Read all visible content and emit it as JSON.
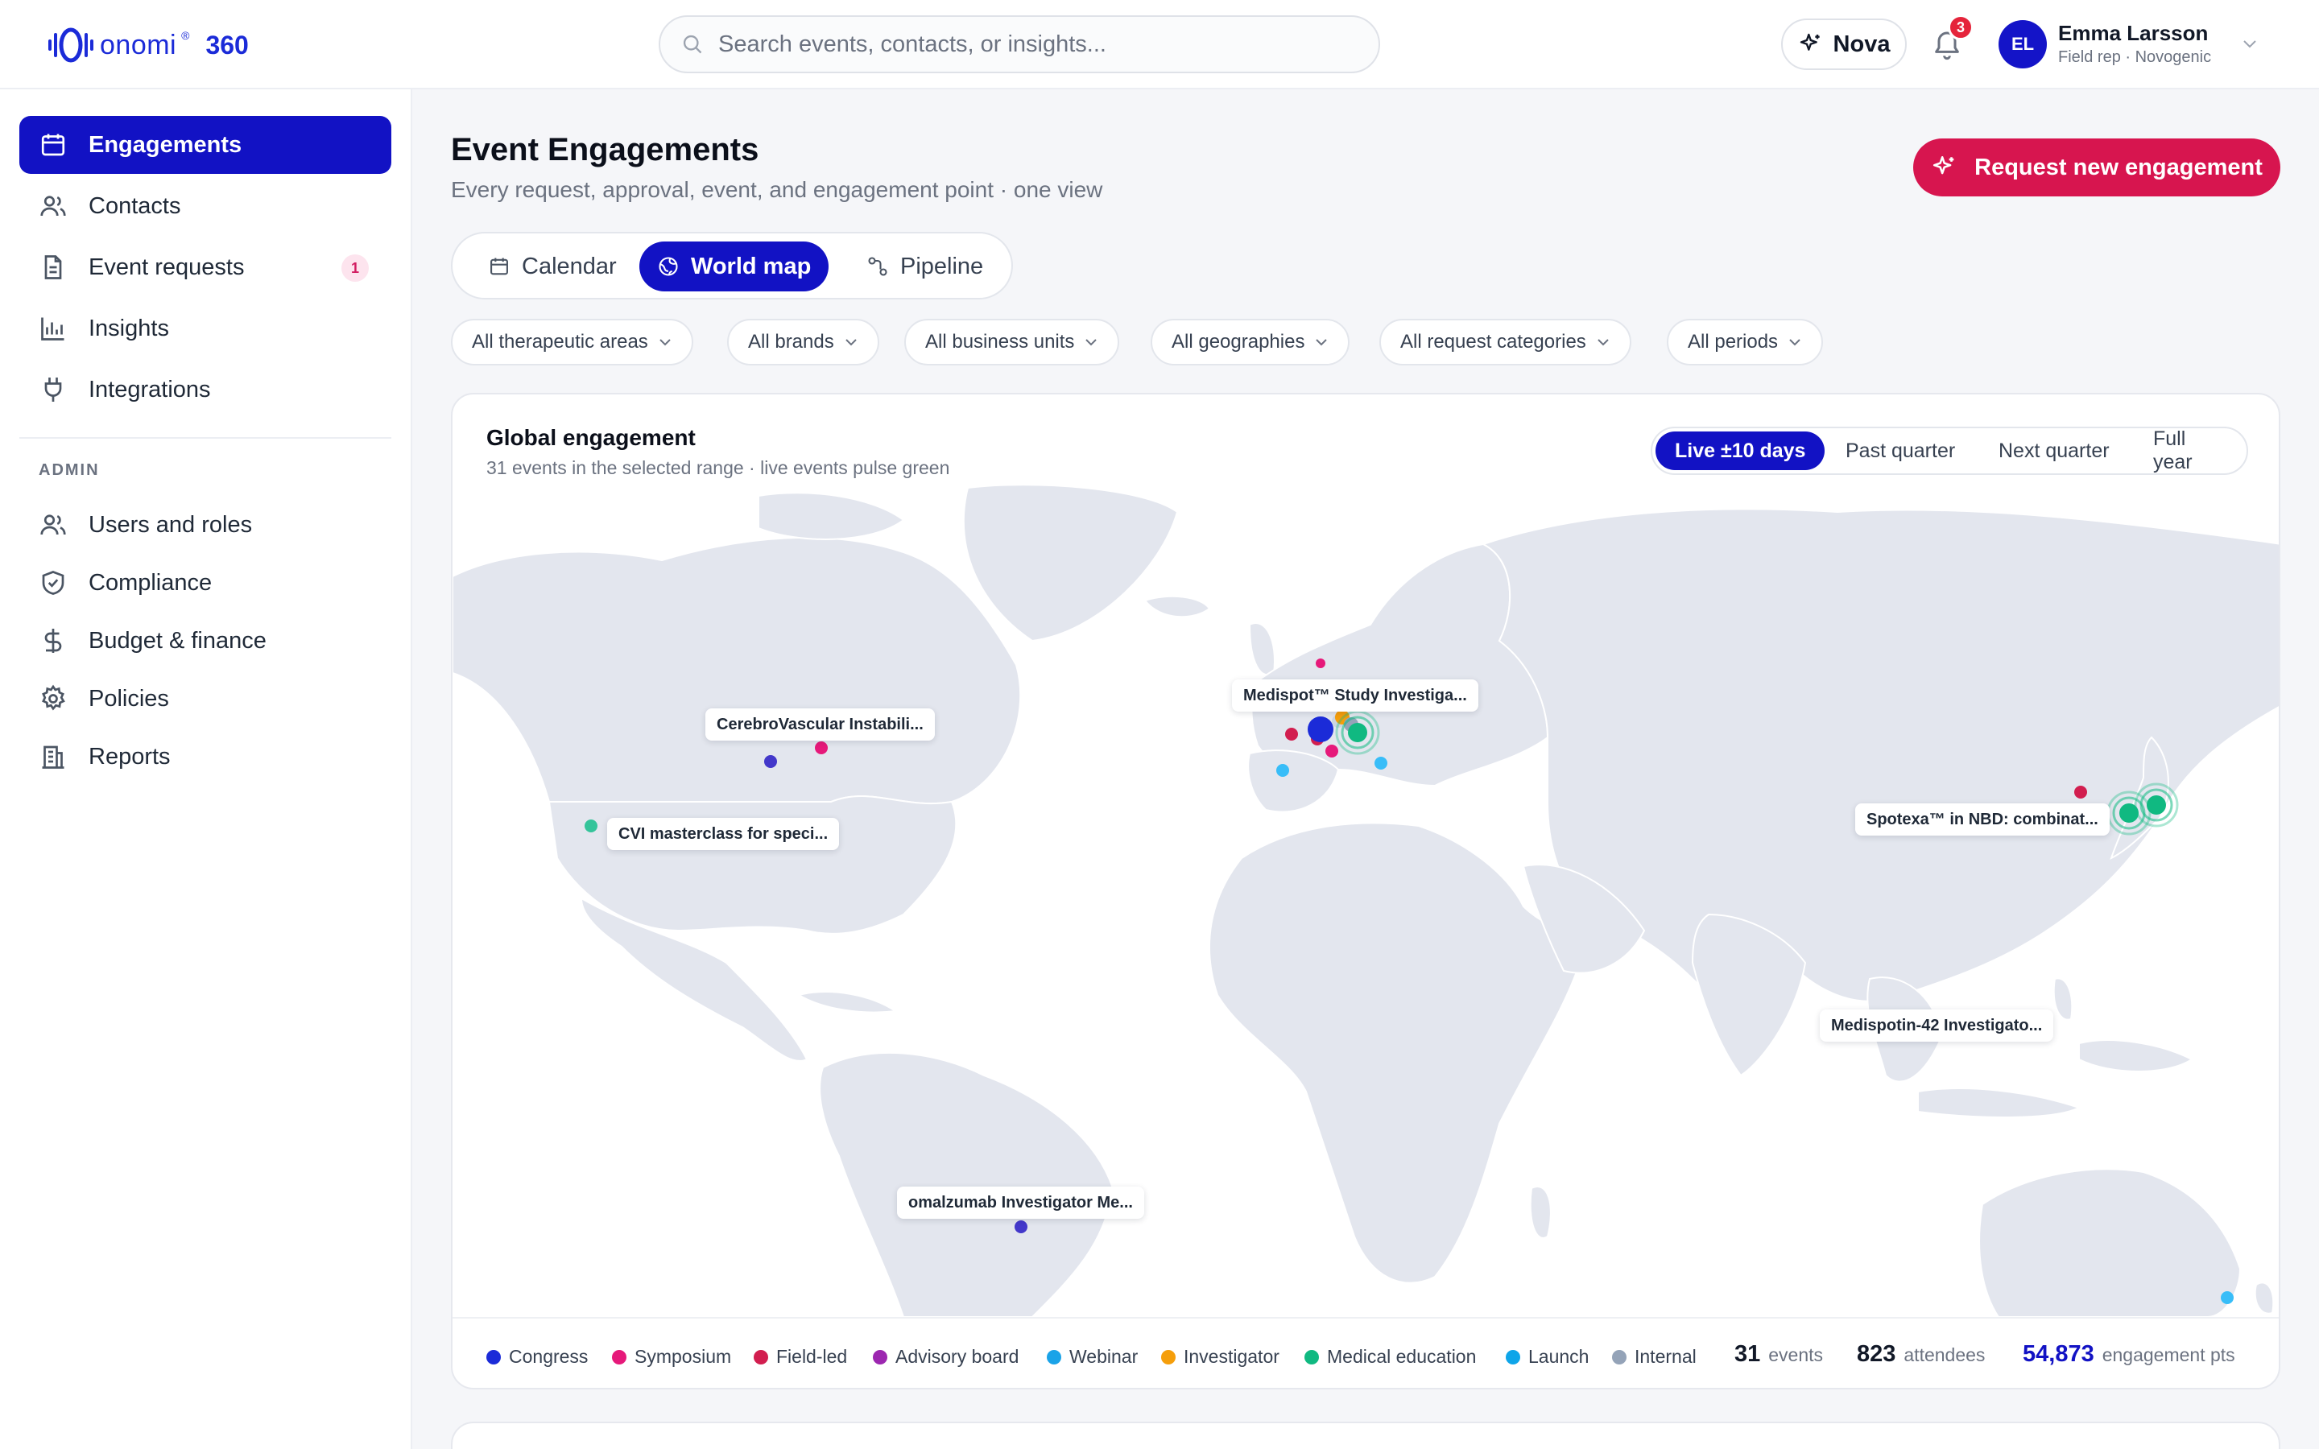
{
  "brand": {
    "name": "onomi",
    "reg": "®",
    "suffix": "360"
  },
  "search": {
    "placeholder": "Search events, contacts, or insights..."
  },
  "header": {
    "nova_label": "Nova",
    "notifications_count": "3",
    "user": {
      "initials": "EL",
      "name": "Emma Larsson",
      "role": "Field rep · Novogenic"
    }
  },
  "sidebar": {
    "items": [
      {
        "label": "Engagements",
        "icon": "calendar-icon",
        "active": true
      },
      {
        "label": "Contacts",
        "icon": "users-icon"
      },
      {
        "label": "Event requests",
        "icon": "document-icon",
        "badge": "1"
      },
      {
        "label": "Insights",
        "icon": "bar-chart-icon"
      },
      {
        "label": "Integrations",
        "icon": "plug-icon"
      }
    ],
    "admin_section": "ADMIN",
    "admin_items": [
      {
        "label": "Users and roles",
        "icon": "users-icon"
      },
      {
        "label": "Compliance",
        "icon": "shield-icon"
      },
      {
        "label": "Budget & finance",
        "icon": "dollar-icon"
      },
      {
        "label": "Policies",
        "icon": "gear-icon"
      },
      {
        "label": "Reports",
        "icon": "building-icon"
      }
    ]
  },
  "main": {
    "title": "Event Engagements",
    "subtitle": "Every request, approval, event, and engagement point · one view",
    "request_button": "Request new engagement",
    "views": [
      {
        "label": "Calendar",
        "icon": "calendar-icon"
      },
      {
        "label": "World map",
        "icon": "globe-icon",
        "active": true
      },
      {
        "label": "Pipeline",
        "icon": "pipeline-icon"
      }
    ],
    "filters": [
      "All therapeutic areas",
      "All brands",
      "All business units",
      "All geographies",
      "All request categories",
      "All periods"
    ]
  },
  "map_card": {
    "title": "Global engagement",
    "subtitle": "31 events in the selected range · live events pulse green",
    "ranges": [
      {
        "label": "Live ±10 days",
        "active": true
      },
      {
        "label": "Past quarter"
      },
      {
        "label": "Next quarter"
      },
      {
        "label": "Full year"
      }
    ],
    "callouts": [
      "Medispot™ Study Investiga...",
      "CerebroVascular Instabili...",
      "CVI masterclass for speci...",
      "Spotexa™ in NBD: combinat...",
      "Medispotin-42 Investigato...",
      "omalzumab Investigator Me..."
    ],
    "legend": [
      {
        "label": "Congress",
        "color": "#1b2bd8"
      },
      {
        "label": "Symposium",
        "color": "#e6197a"
      },
      {
        "label": "Field-led",
        "color": "#d21e4f"
      },
      {
        "label": "Advisory board",
        "color": "#9c27b0"
      },
      {
        "label": "Webinar",
        "color": "#1aa3e8"
      },
      {
        "label": "Investigator",
        "color": "#f59e0b"
      },
      {
        "label": "Medical education",
        "color": "#10b981"
      },
      {
        "label": "Launch",
        "color": "#0ea5e9"
      },
      {
        "label": "Internal",
        "color": "#94a3b8"
      }
    ],
    "stats": [
      {
        "value": "31",
        "label": "events"
      },
      {
        "value": "823",
        "label": "attendees"
      },
      {
        "value": "54,873",
        "label": "engagement pts"
      }
    ]
  }
}
